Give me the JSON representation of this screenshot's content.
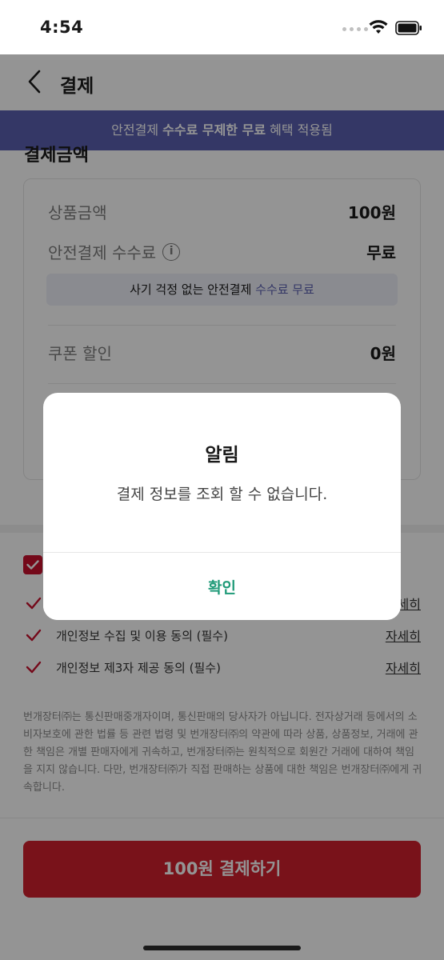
{
  "status_bar": {
    "time": "4:54"
  },
  "header": {
    "title": "결제"
  },
  "banner": {
    "prefix": "안전결제 ",
    "highlight": "수수료 무제한 무료",
    "suffix": " 혜택 적용됨"
  },
  "summary": {
    "section_title": "결제금액",
    "product_amount_label": "상품금액",
    "product_amount_value": "100원",
    "fee_label": "안전결제 수수료",
    "fee_value": "무료",
    "fee_note_prefix": "사기 걱정 없는 안전결제 ",
    "fee_note_highlight": "수수료 무료",
    "coupon_label": "쿠폰 할인",
    "coupon_value": "0원"
  },
  "agreements": {
    "items": [
      {
        "label": "개인정보 수집 및 이용 동의 (필수)",
        "link": "자세히"
      },
      {
        "label": "개인정보 제3자 제공 동의 (필수)",
        "link": "자세히"
      }
    ],
    "hidden_link": "자세히"
  },
  "disclaimer": "번개장터㈜는 통신판매중개자이며, 통신판매의 당사자가 아닙니다. 전자상거래 등에서의 소비자보호에 관한 법률 등 관련 법령 및 번개장터㈜의 약관에 따라 상품, 상품정보, 거래에 관한 책임은 개별 판매자에게 귀속하고, 번개장터㈜는 원칙적으로 회원간 거래에 대하여 책임을 지지 않습니다. 다만, 번개장터㈜가 직접 판매하는 상품에 대한 책임은 번개장터㈜에게 귀속합니다.",
  "pay_button": {
    "label": "100원 결제하기"
  },
  "dialog": {
    "title": "알림",
    "message": "결제 정보를 조회 할 수 없습니다.",
    "confirm": "확인"
  },
  "colors": {
    "banner": "#5b5fb0",
    "pay_button": "#d11f2e",
    "confirm": "#1f9a78",
    "check": "#c8102e"
  }
}
